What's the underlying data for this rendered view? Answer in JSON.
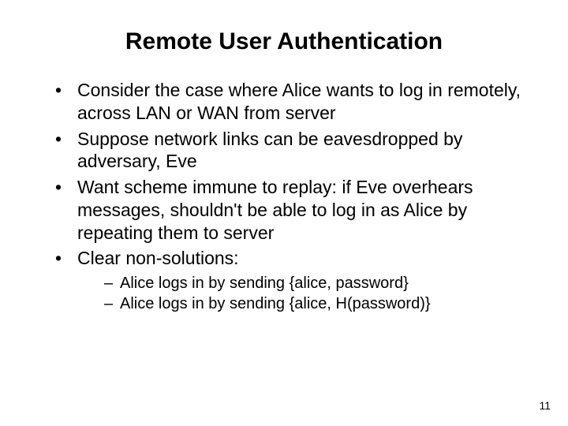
{
  "title": "Remote User Authentication",
  "bullets": {
    "b1": "Consider the case where Alice wants to log in remotely, across LAN or WAN from server",
    "b2": "Suppose network links can be eavesdropped by adversary, Eve",
    "b3": "Want scheme immune to replay: if Eve overhears messages, shouldn't be able to log in as Alice by repeating them to server",
    "b4": "Clear non-solutions:"
  },
  "sub": {
    "s1": "Alice logs in by sending {alice, password}",
    "s2": "Alice logs in by sending {alice, H(password)}"
  },
  "page": "11"
}
